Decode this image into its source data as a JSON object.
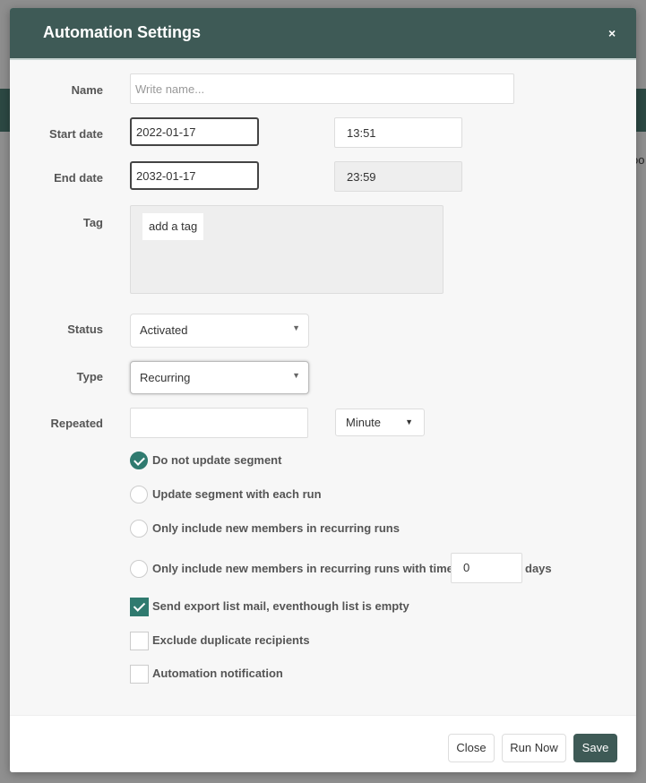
{
  "background": {
    "partial_text": "oo"
  },
  "modal": {
    "title": "Automation Settings",
    "close_glyph": "×"
  },
  "form": {
    "name": {
      "label": "Name",
      "placeholder": "Write name...",
      "value": ""
    },
    "start_date": {
      "label": "Start date",
      "date": "2022-01-17",
      "time": "13:51"
    },
    "end_date": {
      "label": "End date",
      "date": "2032-01-17",
      "time": "23:59"
    },
    "tag": {
      "label": "Tag",
      "placeholder": "add a tag"
    },
    "status": {
      "label": "Status",
      "selected": "Activated"
    },
    "type": {
      "label": "Type",
      "selected": "Recurring"
    },
    "repeated": {
      "label": "Repeated",
      "value": "",
      "unit": "Minute"
    }
  },
  "segment_options": [
    {
      "label": "Do not update segment",
      "checked": true
    },
    {
      "label": "Update segment with each run",
      "checked": false
    },
    {
      "label": "Only include new members in recurring runs",
      "checked": false
    },
    {
      "label": "Only include new members in recurring runs with time limit",
      "checked": false
    }
  ],
  "time_limit": {
    "value": "0",
    "unit_label": "days"
  },
  "checkboxes": [
    {
      "label": "Send export list mail, eventhough list is empty",
      "checked": true
    },
    {
      "label": "Exclude duplicate recipients",
      "checked": false
    },
    {
      "label": "Automation notification",
      "checked": false
    }
  ],
  "footer": {
    "close_label": "Close",
    "run_now_label": "Run Now",
    "save_label": "Save"
  },
  "colors": {
    "header": "#3e5a56",
    "accent": "#2f7a6f"
  }
}
